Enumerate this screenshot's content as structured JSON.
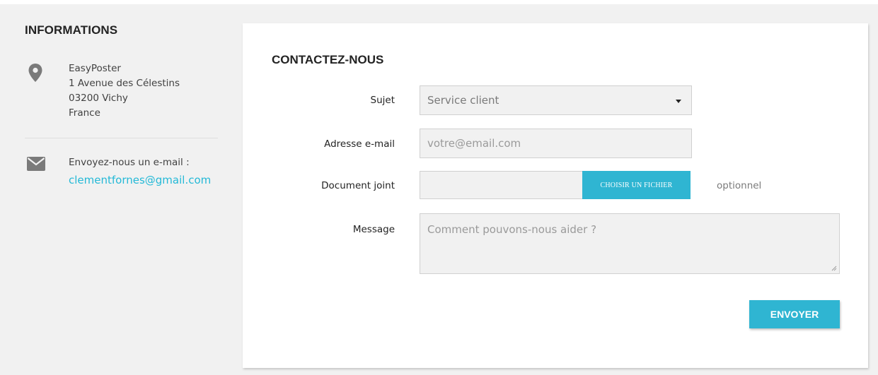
{
  "sidebar": {
    "title": "INFORMATIONS",
    "address": {
      "icon": "map-pin-icon",
      "lines": [
        "EasyPoster",
        "1 Avenue des Célestins",
        "03200 Vichy",
        "France"
      ]
    },
    "email": {
      "icon": "envelope-icon",
      "label": "Envoyez-nous un e-mail :",
      "address": "clementfornes@gmail.com"
    }
  },
  "form": {
    "title": "CONTACTEZ-NOUS",
    "subject": {
      "label": "Sujet",
      "value": "Service client",
      "icon": "caret-down-icon"
    },
    "email": {
      "label": "Adresse e-mail",
      "placeholder": "votre@email.com"
    },
    "attachment": {
      "label": "Document joint",
      "button_label": "CHOISIR UN FICHIER",
      "hint": "optionnel"
    },
    "message": {
      "label": "Message",
      "placeholder": "Comment pouvons-nous aider ?"
    },
    "submit_label": "ENVOYER"
  },
  "colors": {
    "accent": "#2fb5d2",
    "link": "#24b9d7",
    "background": "#f1f1f1",
    "card": "#ffffff"
  }
}
